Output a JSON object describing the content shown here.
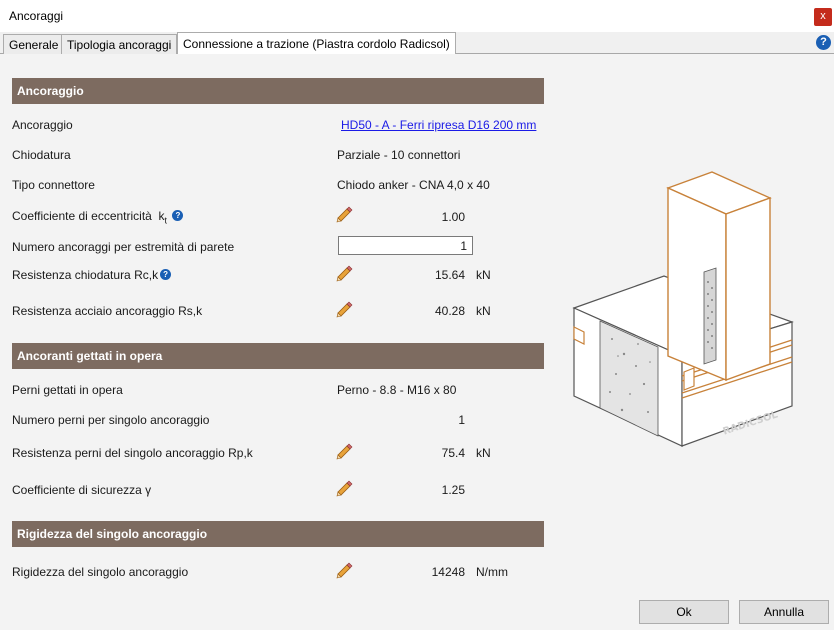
{
  "window": {
    "title": "Ancoraggi",
    "close_glyph": "x"
  },
  "tabs": [
    {
      "label": "Generale"
    },
    {
      "label": "Tipologia ancoraggi"
    },
    {
      "label": "Connessione a trazione (Piastra cordolo Radicsol)"
    }
  ],
  "help_glyph": "?",
  "sections": {
    "ancoraggio": {
      "title": "Ancoraggio",
      "rows": {
        "ancoraggio": {
          "label": "Ancoraggio",
          "value": "HD50 - A - Ferri ripresa D16 200 mm"
        },
        "chiodatura": {
          "label": "Chiodatura",
          "value": "Parziale - 10 connettori"
        },
        "tipo_connettore": {
          "label": "Tipo connettore",
          "value": "Chiodo anker - CNA 4,0 x 40"
        },
        "coeff_eccentricita": {
          "label": "Coefficiente di eccentricità",
          "symbol": "k",
          "subscript": "t",
          "value": "1.00"
        },
        "numero_ancoraggi": {
          "label": "Numero ancoraggi per estremità di parete",
          "value": "1"
        },
        "resistenza_chiodatura": {
          "label": "Resistenza chiodatura Rc,k",
          "value": "15.64",
          "unit": "kN"
        },
        "resistenza_acciaio": {
          "label": "Resistenza acciaio ancoraggio Rs,k",
          "value": "40.28",
          "unit": "kN"
        }
      }
    },
    "ancoranti": {
      "title": "Ancoranti gettati in opera",
      "rows": {
        "perni": {
          "label": "Perni gettati in opera",
          "value": "Perno - 8.8 - M16 x 80"
        },
        "numero_perni": {
          "label": "Numero perni per singolo ancoraggio",
          "value": "1"
        },
        "resistenza_perni": {
          "label": "Resistenza perni del singolo ancoraggio Rp,k",
          "value": "75.4",
          "unit": "kN"
        },
        "coeff_sicurezza": {
          "label": "Coefficiente di sicurezza γ",
          "value": "1.25"
        }
      }
    },
    "rigidezza": {
      "title": "Rigidezza del singolo ancoraggio",
      "rows": {
        "rigidezza": {
          "label": "Rigidezza del singolo ancoraggio",
          "value": "14248",
          "unit": "N/mm"
        }
      }
    }
  },
  "illustration": {
    "brand_text": "RADICSOL"
  },
  "buttons": {
    "ok": "Ok",
    "cancel": "Annulla"
  },
  "colors": {
    "section_header": "#7d6b60",
    "wood_outline": "#c8823a",
    "link": "#1a1ae6",
    "close": "#c42b1c"
  }
}
